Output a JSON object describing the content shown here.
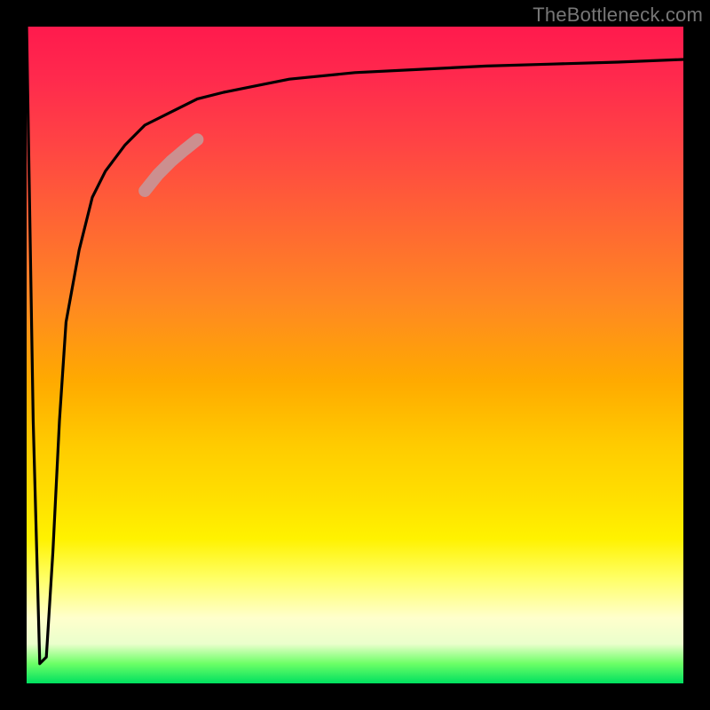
{
  "watermark": "TheBottleneck.com",
  "chart_data": {
    "type": "line",
    "title": "",
    "xlabel": "",
    "ylabel": "",
    "xlim": [
      0,
      100
    ],
    "ylim": [
      0,
      100
    ],
    "grid": false,
    "legend": false,
    "background": "vertical-gradient red→yellow→green",
    "series": [
      {
        "name": "bottleneck-curve",
        "color": "#000000",
        "x": [
          0,
          1,
          2,
          3,
          4,
          5,
          6,
          8,
          10,
          12,
          15,
          18,
          22,
          26,
          30,
          35,
          40,
          50,
          60,
          70,
          80,
          90,
          100
        ],
        "y": [
          100,
          40,
          3,
          4,
          20,
          40,
          55,
          66,
          74,
          78,
          82,
          85,
          87,
          89,
          90,
          91,
          92,
          93,
          93.5,
          94,
          94.3,
          94.6,
          95
        ]
      }
    ],
    "highlight": {
      "name": "thick-segment",
      "color": "#cc8f8f",
      "stroke_width": 14,
      "x": [
        18,
        20,
        22,
        24,
        26
      ],
      "y": [
        75,
        77.5,
        79.5,
        81.2,
        82.8
      ]
    }
  }
}
